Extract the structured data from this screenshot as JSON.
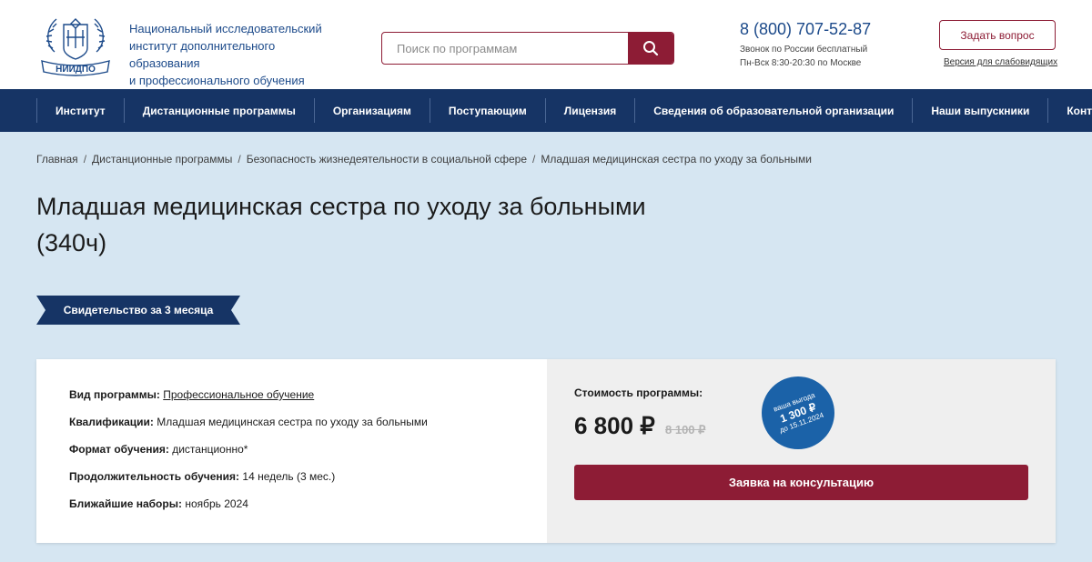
{
  "header": {
    "logo_text": "НИИДПО",
    "org_name_line1": "Национальный исследовательский",
    "org_name_line2": "институт дополнительного образования",
    "org_name_line3": "и профессионального обучения",
    "search_placeholder": "Поиск по программам",
    "phone": "8 (800) 707-52-87",
    "phone_note_line1": "Звонок по России бесплатный",
    "phone_note_line2": "Пн-Вск 8:30-20:30 по Москве",
    "ask_button": "Задать вопрос",
    "low_vision_link": "Версия для слабовидящих"
  },
  "nav": {
    "items": [
      "Институт",
      "Дистанционные программы",
      "Организациям",
      "Поступающим",
      "Лицензия",
      "Сведения об образовательной организации",
      "Наши выпускники",
      "Контакты"
    ]
  },
  "breadcrumb": [
    "Главная",
    "Дистанционные программы",
    "Безопасность жизнедеятельности в социальной сфере",
    "Младшая медицинская сестра по уходу за больными"
  ],
  "page": {
    "title_line1": "Младшая медицинская сестра по уходу за больными",
    "title_line2": "(340ч)",
    "ribbon": "Свидетельство за 3 месяца"
  },
  "details": [
    {
      "label": "Вид программы:",
      "value": "Профессиональное обучение"
    },
    {
      "label": "Квалификации:",
      "value": "Младшая медицинская сестра по уходу за больными"
    },
    {
      "label": "Формат обучения:",
      "value": "дистанционно*"
    },
    {
      "label": "Продолжительность обучения:",
      "value": "14 недель (3 мес.)"
    },
    {
      "label": "Ближайшие наборы:",
      "value": "ноябрь 2024"
    }
  ],
  "pricing": {
    "cost_label": "Стоимость программы:",
    "price": "6 800 ₽",
    "old_price": "8 100 ₽",
    "badge_line1": "ваша выгода",
    "badge_line2": "1 300 ₽",
    "badge_line3": "до 15.11.2024",
    "consult_button": "Заявка на консультацию"
  },
  "colors": {
    "brand_red": "#8d1c35",
    "nav_blue": "#163465",
    "badge_blue": "#1b62a8",
    "page_bg": "#d6e6f2"
  }
}
